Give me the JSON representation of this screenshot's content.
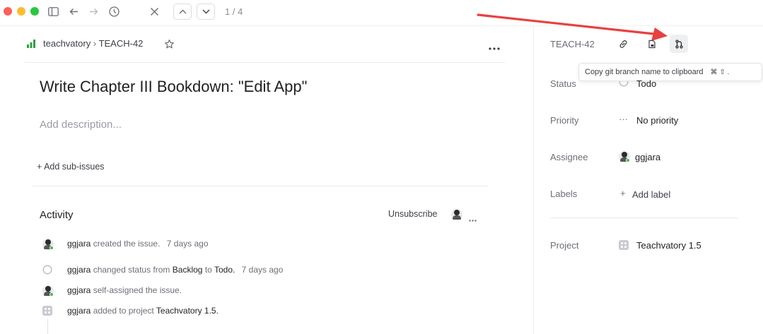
{
  "toolbar": {
    "pager": "1 / 4"
  },
  "breadcrumb": {
    "team": "teachvatory",
    "separator": "›",
    "issue_id": "TEACH-42"
  },
  "issue": {
    "title": "Write Chapter III Bookdown: \"Edit App\"",
    "description_placeholder": "Add description...",
    "add_subissues": "+ Add sub-issues"
  },
  "activity": {
    "heading": "Activity",
    "unsubscribe": "Unsubscribe",
    "events": [
      {
        "user": "ggjara",
        "text": "created the issue.",
        "time": "7 days ago"
      },
      {
        "user": "ggjara",
        "pre": "changed status from",
        "from": "Backlog",
        "mid": "to",
        "to": "Todo.",
        "time": "7 days ago"
      },
      {
        "user": "ggjara",
        "text": "self-assigned the issue."
      },
      {
        "user": "ggjara",
        "pre": "added to project",
        "project": "Teachvatory 1.5."
      }
    ]
  },
  "sidebar": {
    "issue_id": "TEACH-42",
    "tooltip": "Copy git branch name to clipboard",
    "tooltip_keys": "⌘  ⇧  .",
    "status_label": "Status",
    "status_value": "Todo",
    "priority_label": "Priority",
    "priority_value": "No priority",
    "priority_icon": "···",
    "assignee_label": "Assignee",
    "assignee_value": "ggjara",
    "labels_label": "Labels",
    "labels_value": "Add label",
    "labels_plus": "+",
    "project_label": "Project",
    "project_value": "Teachvatory 1.5"
  },
  "colors": {
    "close": "#ff5f57",
    "minimize": "#febc2e",
    "zoom": "#28c840",
    "annotation_arrow": "#e8413e",
    "team_icon": "#2ea043"
  }
}
